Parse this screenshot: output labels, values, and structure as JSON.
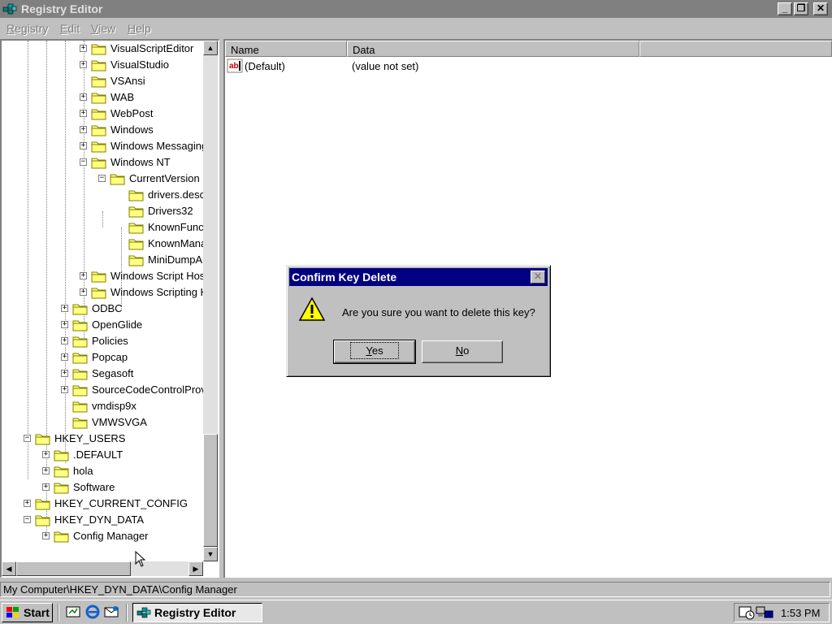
{
  "window": {
    "title": "Registry Editor",
    "controls": {
      "minimize": "_",
      "restore": "❐",
      "close": "✕"
    }
  },
  "menu": [
    {
      "u": "R",
      "rest": "egistry"
    },
    {
      "u": "E",
      "rest": "dit"
    },
    {
      "u": "V",
      "rest": "iew"
    },
    {
      "u": "H",
      "rest": "elp"
    }
  ],
  "tree": [
    {
      "label": "VisualScriptEditor",
      "exp": "+"
    },
    {
      "label": "VisualStudio",
      "exp": "+"
    },
    {
      "label": "VSAnsi",
      "exp": ""
    },
    {
      "label": "WAB",
      "exp": "+"
    },
    {
      "label": "WebPost",
      "exp": "+"
    },
    {
      "label": "Windows",
      "exp": "+"
    },
    {
      "label": "Windows Messaging Subsystem",
      "exp": "+"
    },
    {
      "label": "Windows NT",
      "exp": "−"
    },
    {
      "label": "CurrentVersion",
      "exp": "−"
    },
    {
      "label": "drivers.desc",
      "exp": ""
    },
    {
      "label": "Drivers32",
      "exp": ""
    },
    {
      "label": "KnownFunctionTableDlls",
      "exp": ""
    },
    {
      "label": "KnownManagedDebuggingDlls",
      "exp": ""
    },
    {
      "label": "MiniDumpAuxiliaryDlls",
      "exp": ""
    },
    {
      "label": "Windows Script Host",
      "exp": "+"
    },
    {
      "label": "Windows Scripting Host",
      "exp": "+"
    },
    {
      "label": "ODBC",
      "exp": "+"
    },
    {
      "label": "OpenGlide",
      "exp": "+"
    },
    {
      "label": "Policies",
      "exp": "+"
    },
    {
      "label": "Popcap",
      "exp": "+"
    },
    {
      "label": "Segasoft",
      "exp": "+"
    },
    {
      "label": "SourceCodeControlProvider",
      "exp": "+"
    },
    {
      "label": "vmdisp9x",
      "exp": ""
    },
    {
      "label": "VMWSVGA",
      "exp": ""
    },
    {
      "label": "HKEY_USERS",
      "exp": "−"
    },
    {
      "label": ".DEFAULT",
      "exp": "+"
    },
    {
      "label": "hola",
      "exp": "+"
    },
    {
      "label": "Software",
      "exp": "+"
    },
    {
      "label": "HKEY_CURRENT_CONFIG",
      "exp": "+"
    },
    {
      "label": "HKEY_DYN_DATA",
      "exp": "−"
    },
    {
      "label": "Config Manager",
      "exp": "+"
    }
  ],
  "list": {
    "columns": [
      "Name",
      "Data"
    ],
    "rows": [
      {
        "name": "(Default)",
        "data": "(value not set)",
        "icon": "string-value-icon"
      }
    ]
  },
  "statusbar": {
    "path": "My Computer\\HKEY_DYN_DATA\\Config Manager"
  },
  "dialog": {
    "title": "Confirm Key Delete",
    "message": "Are you sure you want to delete this key?",
    "yes_u": "Y",
    "yes_rest": "es",
    "no_u": "N",
    "no_rest": "o",
    "close": "✕",
    "icon": "warning-icon"
  },
  "taskbar": {
    "start": "Start",
    "task": "Registry Editor",
    "clock": "1:53 PM"
  },
  "colors": {
    "selection": "#000080",
    "inactive_title": "#808080",
    "face": "#c0c0c0"
  }
}
